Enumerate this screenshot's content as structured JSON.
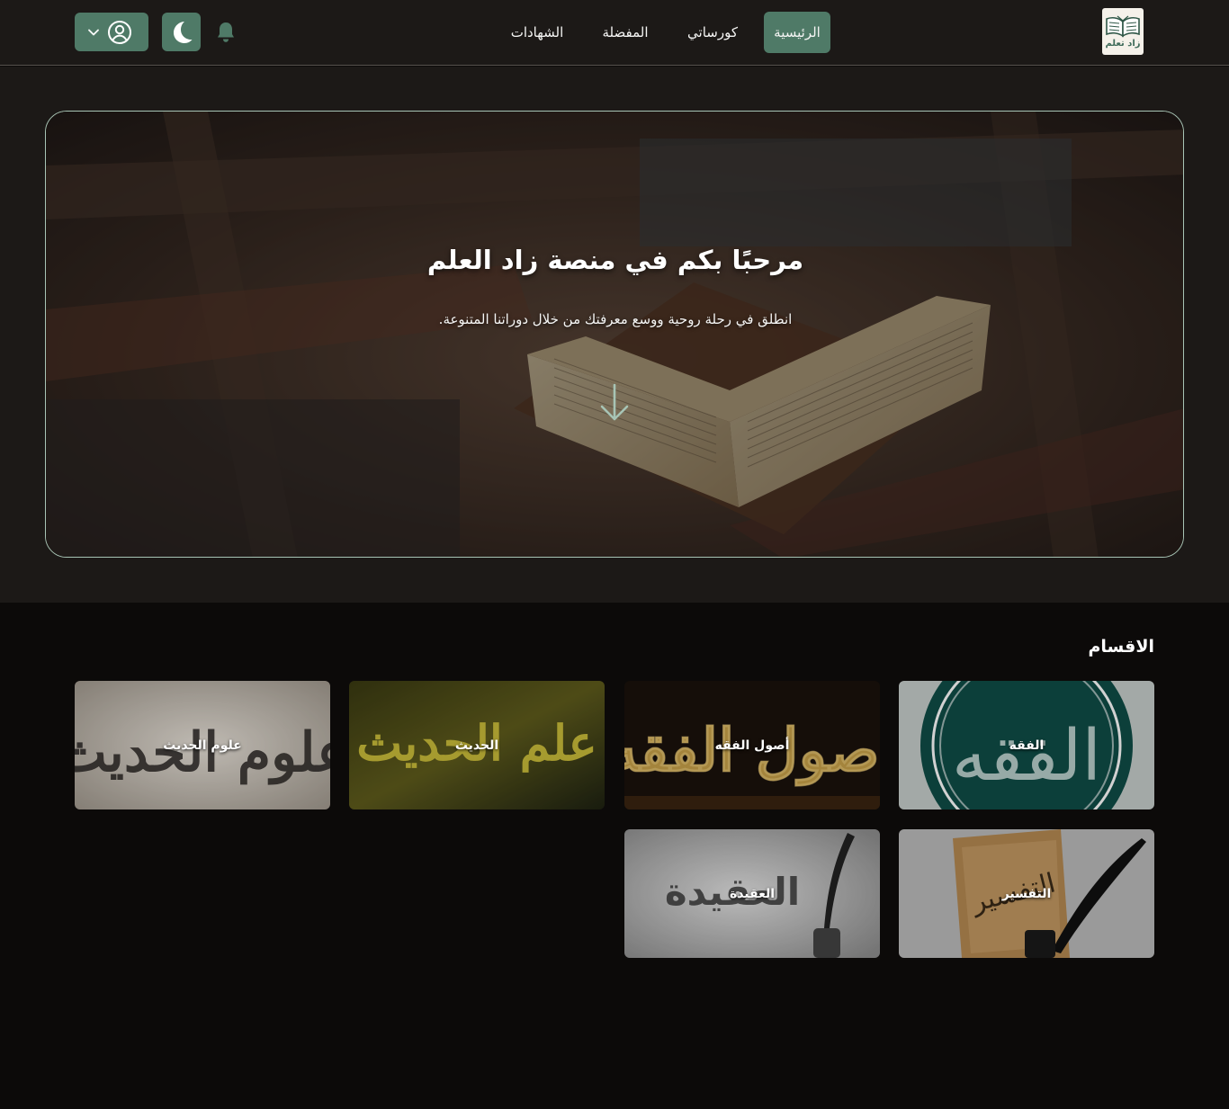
{
  "header": {
    "logo_text": "زاد تعلم",
    "nav": [
      {
        "label": "الرئيسية",
        "active": true
      },
      {
        "label": "كورساتي",
        "active": false
      },
      {
        "label": "المفضلة",
        "active": false
      },
      {
        "label": "الشهادات",
        "active": false
      }
    ],
    "icons": {
      "bell": "bell-icon",
      "theme": "moon-icon",
      "user": "user-circle-icon",
      "dropdown": "chevron-down-icon"
    }
  },
  "hero": {
    "title": "مرحبًا بكم في منصة زاد العلم",
    "subtitle": "انطلق في رحلة روحية ووسع معرفتك من خلال دوراتنا المتنوعة.",
    "arrow_icon": "arrow-down-icon"
  },
  "sections": {
    "title": "الاقسام",
    "items": [
      {
        "label": "الفقه",
        "art": "الفقه"
      },
      {
        "label": "أصول الفقه",
        "art": "أصول الفقه"
      },
      {
        "label": "الحديث",
        "art": "علم الحديث"
      },
      {
        "label": "علوم الحديث",
        "art": "علوم الحديث"
      },
      {
        "label": "التفسير",
        "art": "التفسير"
      },
      {
        "label": "العقيدة",
        "art": "العقيدة"
      }
    ]
  },
  "colors": {
    "accent": "#4f7a67",
    "header_bg": "#1c1917",
    "page_bg": "#0c0a09",
    "hero_border": "#a7c4b5"
  }
}
